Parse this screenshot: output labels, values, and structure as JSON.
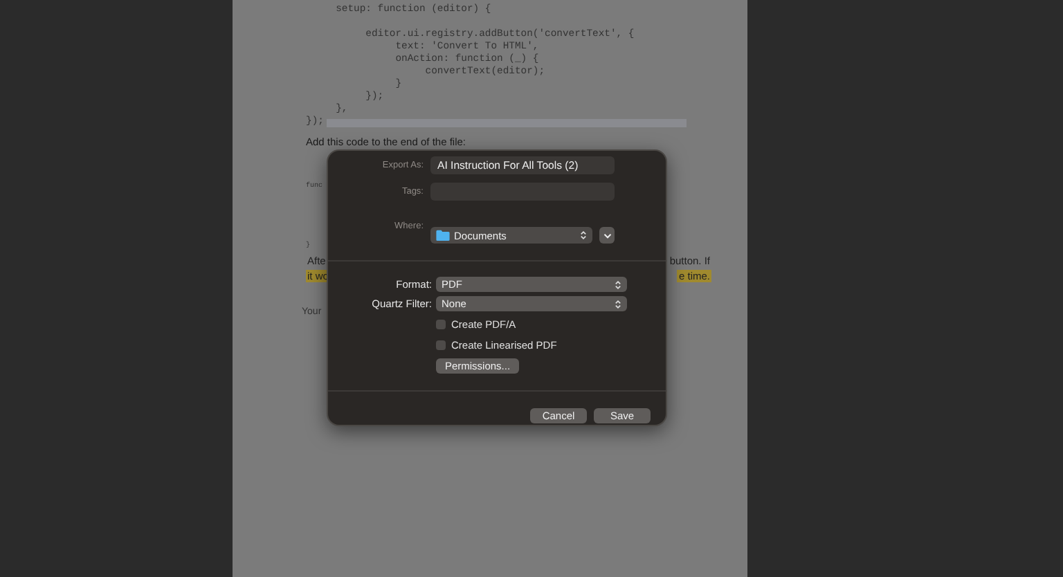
{
  "document": {
    "code_lines": [
      {
        "text": "     setup: function (editor) {",
        "highlighted": false
      },
      {
        "text": "          editor.ui.registry.addButton('convertText', {",
        "highlighted": false
      },
      {
        "text": "               text: 'Convert To HTML',",
        "highlighted": false
      },
      {
        "text": "               onAction: function (_) {",
        "highlighted": false
      },
      {
        "text": "                    convertText(editor);",
        "highlighted": false
      },
      {
        "text": "               }",
        "highlighted": false
      },
      {
        "text": "          });",
        "highlighted": false
      },
      {
        "text": "     },",
        "highlighted": false
      },
      {
        "text": "});",
        "highlighted": true
      }
    ],
    "intro": "Add this code to the end of the file:",
    "code_fragments": [
      "func",
      "}"
    ],
    "paragraph_rows": [
      {
        "left": {
          "text": "Afte",
          "highlighted": false
        },
        "right": {
          "text": "button. If",
          "highlighted": false
        }
      },
      {
        "left": {
          "text": "it wo",
          "highlighted": true
        },
        "right": {
          "text": "e time.",
          "highlighted": true
        }
      }
    ],
    "footer": "Your"
  },
  "dialog": {
    "export_as": {
      "label": "Export As:",
      "value": "AI Instruction For All Tools (2)"
    },
    "tags": {
      "label": "Tags:"
    },
    "where": {
      "label": "Where:",
      "value": "Documents"
    },
    "format": {
      "label": "Format:",
      "value": "PDF"
    },
    "quartz_filter": {
      "label": "Quartz Filter:",
      "value": "None"
    },
    "options": [
      {
        "label": "Create PDF/A",
        "checked": false
      },
      {
        "label": "Create Linearised PDF",
        "checked": false
      }
    ],
    "permissions": "Permissions...",
    "buttons": [
      {
        "label": "Cancel"
      },
      {
        "label": "Save"
      }
    ]
  }
}
